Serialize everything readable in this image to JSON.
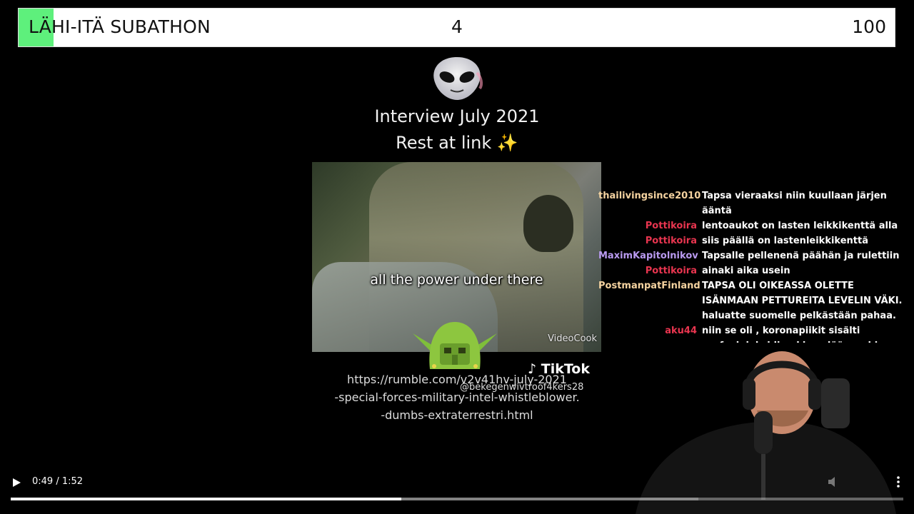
{
  "subathon": {
    "title": "LÄHI-ITÄ SUBATHON",
    "current": "4",
    "goal": "100",
    "progress_fraction": 0.04,
    "fill_color": "#5ef07c"
  },
  "video": {
    "emoji_icon": "alien-icon",
    "caption_line1": "Interview July 2021",
    "caption_line2": "Rest at link",
    "star_icon": "✨",
    "subtitle": "all the power under there",
    "watermark": "VideoCook",
    "tiktok_label": "TikTok",
    "tiktok_user": "@bekegenwivtroof4kers28",
    "link_lines": [
      "https://rumble.com/v2v41hv-july-2021",
      "-special-forces-military-intel-whistleblower.",
      "-dumbs-extraterrestri.html"
    ]
  },
  "chat": [
    {
      "user": "thailivingsince2010",
      "color": "#f5d3a0",
      "message": "Tapsa vieraaksi niin kuullaan järjen ääntä"
    },
    {
      "user": "Pottikoira",
      "color": "#e8354f",
      "message": "lentoaukot on lasten leikkikenttä alla"
    },
    {
      "user": "Pottikoira",
      "color": "#e8354f",
      "message": "siis päällä on lastenleikkikenttä"
    },
    {
      "user": "MaximKapitolnikov",
      "color": "#b99af0",
      "message": "Tapsalle pellenenä päähän ja rulettiin"
    },
    {
      "user": "Pottikoira",
      "color": "#e8354f",
      "message": "ainaki aika usein"
    },
    {
      "user": "PostmanpatFinland",
      "color": "#f5d3a0",
      "message": "TAPSA OLI OIKEASSA OLETTE ISÄNMAAN PETTUREITA LEVELIN VÄKI. haluatte suomelle pelkästään pahaa."
    },
    {
      "user": "aku44",
      "color": "#e8354f",
      "message": "niin se oli , koronapiikit sisälti grafeeinioksidia , kiva elää zombien keskellä"
    }
  ],
  "player": {
    "time": "0:49 / 1:52",
    "progress_fraction": 0.4375,
    "buffered_fraction": 0.77
  }
}
